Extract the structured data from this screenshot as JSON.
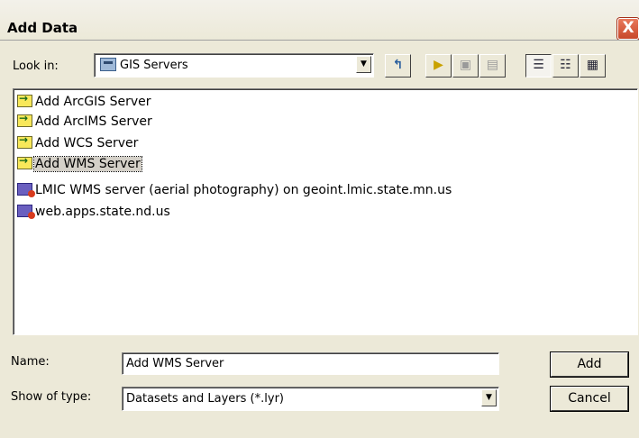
{
  "window": {
    "title": "Add Data",
    "close_glyph": "X"
  },
  "toolbar": {
    "lookin_label": "Look in:",
    "lookin_value": "GIS Servers",
    "buttons": [
      {
        "icon": "up-one-level-icon",
        "glyph": "⬑"
      },
      {
        "icon": "connect-to-folder-icon",
        "glyph": "▶"
      },
      {
        "icon": "disconnect-icon",
        "glyph": "▣"
      },
      {
        "icon": "new-folder-icon",
        "glyph": "▤"
      },
      {
        "icon": "list-view-icon",
        "glyph": "☰"
      },
      {
        "icon": "details-view-icon",
        "glyph": "☷"
      },
      {
        "icon": "thumbnails-view-icon",
        "glyph": "☷"
      }
    ]
  },
  "items": [
    {
      "label": "Add ArcGIS Server",
      "icon": "add-server-icon",
      "selected": false
    },
    {
      "label": "Add ArcIMS Server",
      "icon": "add-server-icon",
      "selected": false
    },
    {
      "label": "Add WCS Server",
      "icon": "add-server-icon",
      "selected": false
    },
    {
      "label": "Add WMS Server",
      "icon": "add-server-icon",
      "selected": true
    },
    {
      "label": "LMIC WMS server (aerial photography) on geoint.lmic.state.mn.us",
      "icon": "server-connection-icon",
      "selected": false
    },
    {
      "label": "web.apps.state.nd.us",
      "icon": "server-connection-icon",
      "selected": false
    }
  ],
  "form": {
    "name_label": "Name:",
    "name_value": "Add WMS Server",
    "type_label": "Show of type:",
    "type_value": "Datasets and Layers (*.lyr)"
  },
  "buttons": {
    "add": "Add",
    "cancel": "Cancel"
  },
  "colors": {
    "dialog_bg": "#ece9d8",
    "close_red": "#c7482b",
    "selection": "#d4d0c8"
  }
}
